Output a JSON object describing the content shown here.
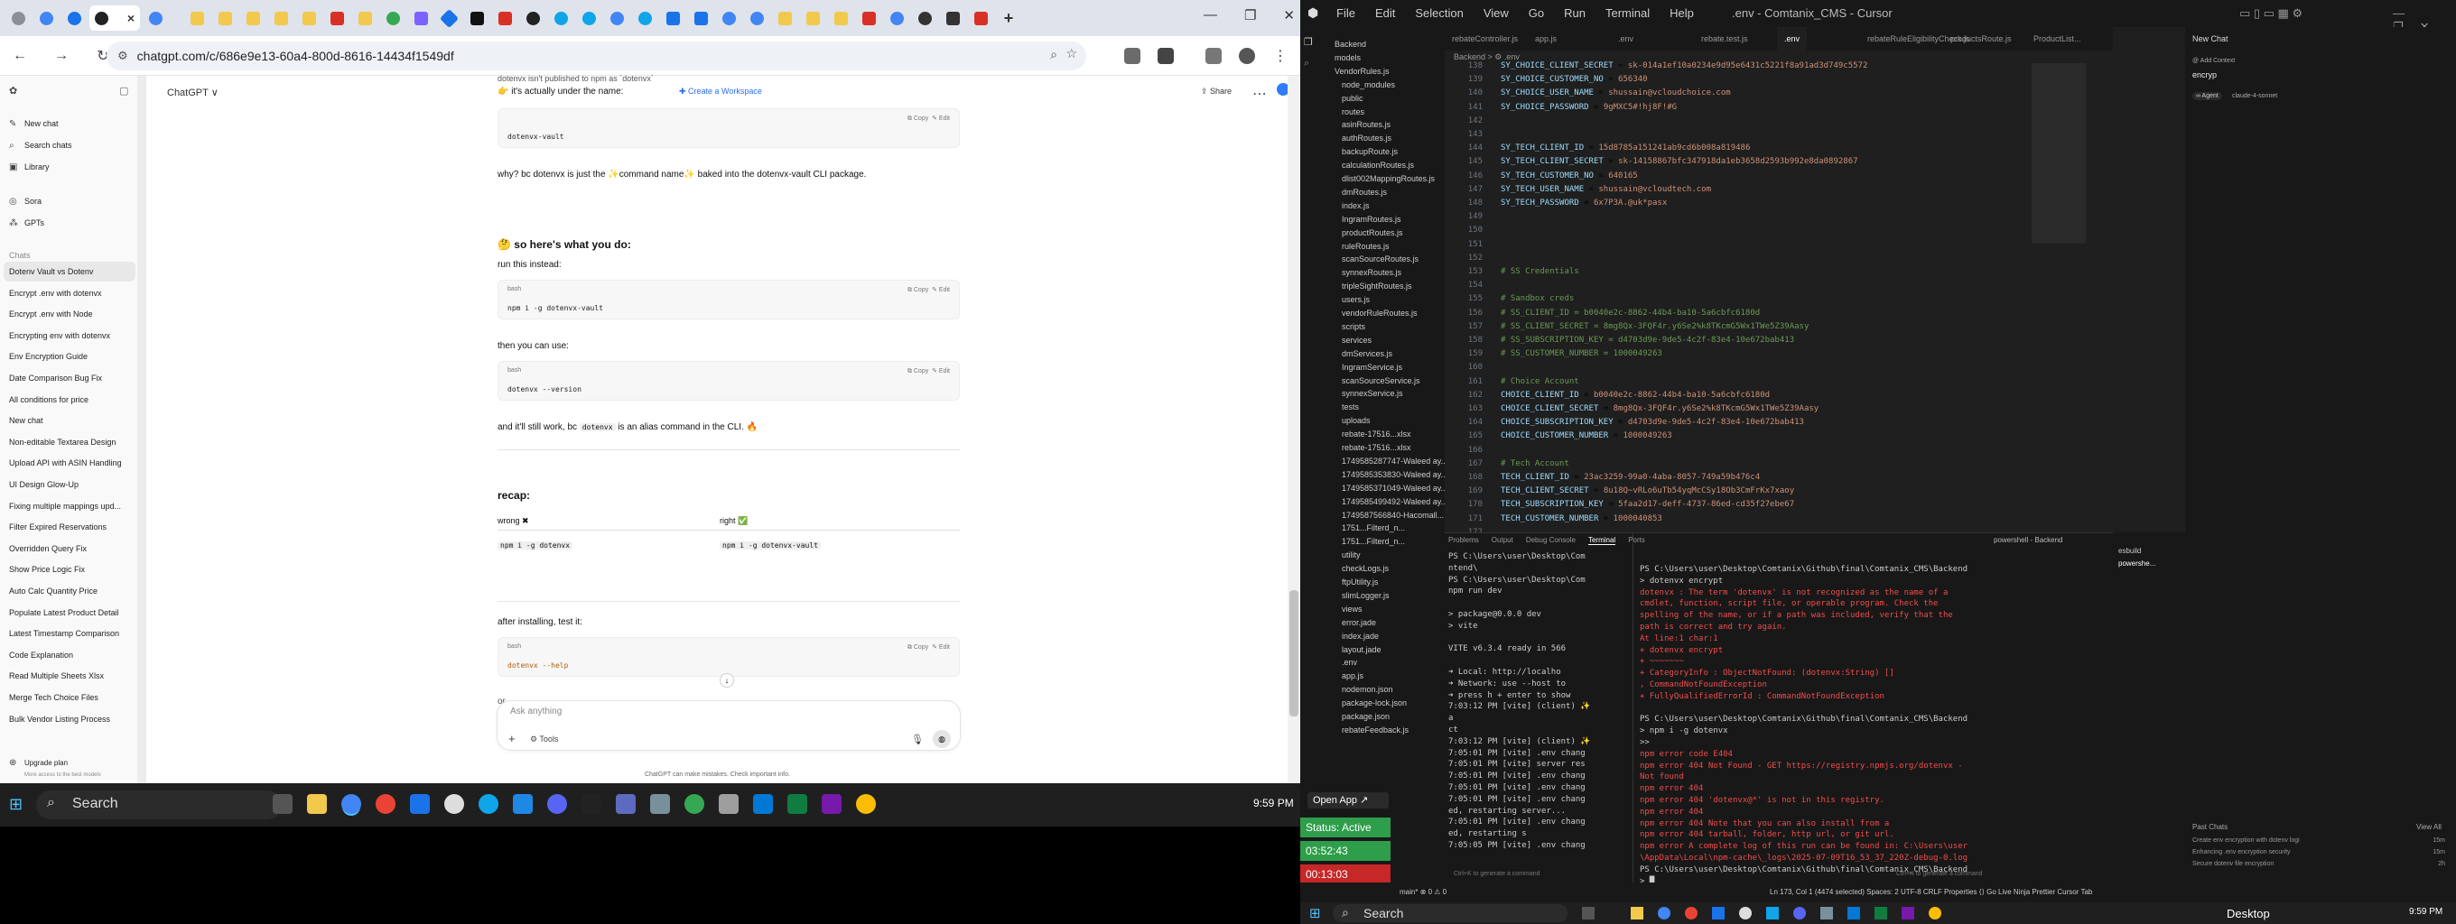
{
  "chrome": {
    "url": "chatgpt.com/c/686e9e13-60a4-800d-8616-14434f1549df",
    "active_tab_close": "×",
    "new_tab": "+",
    "window_controls": [
      "—",
      "❐",
      "✕"
    ]
  },
  "chatgpt": {
    "model_label": "ChatGPT ∨",
    "share_label": "Share",
    "sidebar": {
      "top": [
        "New chat",
        "Search chats",
        "Library",
        "Sora",
        "GPTs"
      ],
      "section": "Chats",
      "chats": [
        "Dotenv Vault vs Dotenv",
        "Encrypt .env with dotenvx",
        "Encrypt .env with Node",
        "Encrypting env with dotenvx",
        "Env Encryption Guide",
        "Date Comparison Bug Fix",
        "All conditions for price",
        "New chat",
        "Non-editable Textarea Design",
        "Upload API with ASIN Handling",
        "UI Design Glow-Up",
        "Fixing multiple mappings upd...",
        "Filter Expired Reservations",
        "Overridden Query Fix",
        "Show Price Logic Fix",
        "Auto Calc Quantity Price",
        "Populate Latest Product Detail",
        "Latest Timestamp Comparison",
        "Code Explanation",
        "Read Multiple Sheets Xlsx",
        "Merge Tech Choice Files",
        "Bulk Vendor Listing Process"
      ],
      "upgrade": "Upgrade plan",
      "upgrade_sub": "More access to the best models"
    },
    "messages": {
      "top_cut": "dotenvx isn't published to npm as `dotenvx`",
      "actually": "👉 it's actually under the name:",
      "create_ws": "✚ Create a Workspace",
      "code1": "dotenvx-vault",
      "why": "why? bc dotenvx is just the ✨command name✨ baked into the dotenvx-vault CLI package.",
      "heading": "🤔 so here's what you do:",
      "run": "run this instead:",
      "code2": "npm i -g dotenvx-vault",
      "then": "then you can use:",
      "code3": "dotenvx --version",
      "still_pre": "and it'll still work, bc",
      "still_code": "dotenvx",
      "still_post": "is an alias command in the CLI. 🔥",
      "recap": "recap:",
      "wrong": "wrong ✖",
      "right": "right ✅",
      "wrong_code": "npm i -g dotenvx",
      "right_code": "npm i -g dotenvx-vault",
      "after": "after installing, test it:",
      "code4": "dotenvx --help",
      "or": "or"
    },
    "code_lang": "bash",
    "copy_label": "⧉ Copy",
    "edit_label": "✎ Edit",
    "composer_placeholder": "Ask anything",
    "tools_label": "Tools",
    "disclaimer": "ChatGPT can make mistakes. Check important info."
  },
  "taskbar_left": {
    "search": "Search",
    "time": "9:59 PM"
  },
  "cursor": {
    "title": ".env - Comtanix_CMS - Cursor",
    "menu": [
      "File",
      "Edit",
      "Selection",
      "View",
      "Go",
      "Run",
      "Terminal",
      "Help"
    ],
    "tabs": [
      "rebateController.js",
      "app.js",
      ".env",
      "rebate.test.js",
      ".env",
      "rebateRuleEligibilityCheck.js",
      "productsRoute.js",
      "ProductList..."
    ],
    "breadcrumb": "Backend > ⚙ .env",
    "explorer": [
      "Backend",
      "models",
      "VendorRules.js",
      "node_modules",
      "public",
      "routes",
      "asinRoutes.js",
      "authRoutes.js",
      "backupRoute.js",
      "calculationRoutes.js",
      "dlist002MappingRoutes.js",
      "dmRoutes.js",
      "index.js",
      "IngramRoutes.js",
      "productRoutes.js",
      "ruleRoutes.js",
      "scanSourceRoutes.js",
      "synnexRoutes.js",
      "tripleSightRoutes.js",
      "users.js",
      "vendorRuleRoutes.js",
      "scripts",
      "services",
      "dmServices.js",
      "IngramService.js",
      "scanSourceService.js",
      "synnexService.js",
      "tests",
      "uploads",
      "rebate-17516...xlsx",
      "rebate-17516...xlsx",
      "1749585287747-Waleed ay...",
      "1749585353830-Waleed ay...",
      "1749585371049-Waleed ay...",
      "1749585499492-Waleed ay...",
      "1749587566840-Hacomall...",
      "1751...Filterd_n...",
      "1751...Filterd_n...",
      "utility",
      "checkLogs.js",
      "ftpUtility.js",
      "slimLogger.js",
      "views",
      "error.jade",
      "index.jade",
      "layout.jade",
      ".env",
      "app.js",
      "nodemon.json",
      "package-lock.json",
      "package.json",
      "rebateFeedback.js"
    ],
    "code_lines": [
      {
        "n": "138",
        "k": "SY_CHOICE_CLIENT_SECRET",
        "v": "sk-014a1ef10a0234e9d95e6431c5221f8a91ad3d749c5572",
        "t": "kv"
      },
      {
        "n": "139",
        "k": "SY_CHOICE_CUSTOMER_NO",
        "v": "656340",
        "t": "kv"
      },
      {
        "n": "140",
        "k": "SY_CHOICE_USER_NAME",
        "v": "shussain@vcloudchoice.com",
        "t": "kv"
      },
      {
        "n": "141",
        "k": "SY_CHOICE_PASSWORD",
        "v": "9gMXC5#!hj8F!#G",
        "t": "kv"
      },
      {
        "n": "142",
        "k": "",
        "v": "",
        "t": "blank"
      },
      {
        "n": "143",
        "k": "",
        "v": "",
        "t": "blank"
      },
      {
        "n": "144",
        "k": "SY_TECH_CLIENT_ID",
        "v": "15d8785a151241ab9cd6b008a819486",
        "t": "kv"
      },
      {
        "n": "145",
        "k": "SY_TECH_CLIENT_SECRET",
        "v": "sk-14158867bfc347918da1eb3658d2593b992e8da0892867",
        "t": "kv"
      },
      {
        "n": "146",
        "k": "SY_TECH_CUSTOMER_NO",
        "v": "640165",
        "t": "kv"
      },
      {
        "n": "147",
        "k": "SY_TECH_USER_NAME",
        "v": "shussain@vcloudtech.com",
        "t": "kv"
      },
      {
        "n": "148",
        "k": "SY_TECH_PASSWORD",
        "v": "6x7P3A.@uk*pasx",
        "t": "kv"
      },
      {
        "n": "149",
        "k": "",
        "v": "",
        "t": "blank"
      },
      {
        "n": "150",
        "k": "",
        "v": "",
        "t": "blank"
      },
      {
        "n": "151",
        "k": "",
        "v": "",
        "t": "blank"
      },
      {
        "n": "152",
        "k": "",
        "v": "",
        "t": "blank"
      },
      {
        "n": "153",
        "k": "",
        "v": "# SS Credentials",
        "t": "comment"
      },
      {
        "n": "154",
        "k": "",
        "v": "",
        "t": "blank"
      },
      {
        "n": "155",
        "k": "",
        "v": "# Sandbox creds",
        "t": "comment"
      },
      {
        "n": "156",
        "k": "",
        "v": "# SS_CLIENT_ID = b0040e2c-8862-44b4-ba10-5a6cbfc6180d",
        "t": "comment"
      },
      {
        "n": "157",
        "k": "",
        "v": "# SS_CLIENT_SECRET = 8mg8Qx-3FQF4r.y6Se2%k8TKcmG5Wx1TWe5Z39Aasy",
        "t": "comment"
      },
      {
        "n": "158",
        "k": "",
        "v": "# SS_SUBSCRIPTION_KEY = d4703d9e-9de5-4c2f-83e4-10e672bab413",
        "t": "comment"
      },
      {
        "n": "159",
        "k": "",
        "v": "# SS_CUSTOMER_NUMBER = 1000049263",
        "t": "comment"
      },
      {
        "n": "160",
        "k": "",
        "v": "",
        "t": "blank"
      },
      {
        "n": "161",
        "k": "",
        "v": "# Choice Account",
        "t": "comment"
      },
      {
        "n": "162",
        "k": "CHOICE_CLIENT_ID",
        "v": "b0040e2c-8862-44b4-ba10-5a6cbfc6180d",
        "t": "kv"
      },
      {
        "n": "163",
        "k": "CHOICE_CLIENT_SECRET",
        "v": "8mg8Qx-3FQF4r.y6Se2%k8TKcmG5Wx1TWe5Z39Aasy",
        "t": "kv"
      },
      {
        "n": "164",
        "k": "CHOICE_SUBSCRIPTION_KEY",
        "v": "d4703d9e-9de5-4c2f-83e4-10e672bab413",
        "t": "kv"
      },
      {
        "n": "165",
        "k": "CHOICE_CUSTOMER_NUMBER",
        "v": "1000049263",
        "t": "kv"
      },
      {
        "n": "166",
        "k": "",
        "v": "",
        "t": "blank"
      },
      {
        "n": "167",
        "k": "",
        "v": "# Tech Account",
        "t": "comment"
      },
      {
        "n": "168",
        "k": "TECH_CLIENT_ID",
        "v": "23ac3259-99a0-4aba-8057-749a59b476c4",
        "t": "kv"
      },
      {
        "n": "169",
        "k": "TECH_CLIENT_SECRET",
        "v": "8u18Q~vRLo6uTb54yqMcCSy18Ob3CmFrKx7xaoy",
        "t": "kv"
      },
      {
        "n": "170",
        "k": "TECH_SUBSCRIPTION_KEY",
        "v": "5faa2d17-deff-4737-86ed-cd35f27ebe67",
        "t": "kv"
      },
      {
        "n": "171",
        "k": "TECH_CUSTOMER_NUMBER",
        "v": "1000040853",
        "t": "kv"
      },
      {
        "n": "172",
        "k": "",
        "v": "",
        "t": "blank"
      },
      {
        "n": "173",
        "k": "",
        "v": "",
        "t": "blank"
      }
    ],
    "panel_tabs": [
      "Problems",
      "Output",
      "Debug Console",
      "Terminal",
      "Ports"
    ],
    "terminal_name": "powershell - Backend",
    "term_left": [
      "PS C:\\Users\\user\\Desktop\\Com",
      "ntend\\",
      "PS C:\\Users\\user\\Desktop\\Com",
      "npm run dev",
      "",
      "> package@0.0.0 dev",
      "> vite",
      "",
      "  VITE v6.3.4  ready in 566",
      "",
      "  ➜  Local:   http://localho",
      "  ➜  Network: use --host to",
      "  ➜  press h + enter to show",
      "7:03:12 PM [vite] (client) ✨",
      "a",
      "ct",
      "7:03:12 PM [vite] (client) ✨",
      "7:05:01 PM [vite] .env chang",
      "7:05:01 PM [vite] server res",
      "7:05:01 PM [vite] .env chang",
      "7:05:01 PM [vite] .env chang",
      "7:05:01 PM [vite] .env chang",
      "ed, restarting server...",
      "7:05:01 PM [vite] .env chang",
      "ed, restarting s",
      "7:05:05 PM [vite] .env chang"
    ],
    "term_right": [
      {
        "t": "PS C:\\Users\\user\\Desktop\\Comtanix\\Github\\final\\Comtanix_CMS\\Backend",
        "c": ""
      },
      {
        "t": "> dotenvx encrypt",
        "c": ""
      },
      {
        "t": "dotenvx : The term 'dotenvx' is not recognized as the name of a",
        "c": "err"
      },
      {
        "t": "cmdlet, function, script file, or operable program. Check the",
        "c": "err"
      },
      {
        "t": "spelling of the name, or if a path was included, verify that the",
        "c": "err"
      },
      {
        "t": "path is correct and try again.",
        "c": "err"
      },
      {
        "t": "At line:1 char:1",
        "c": "err"
      },
      {
        "t": "+ dotenvx encrypt",
        "c": "err"
      },
      {
        "t": "+ ~~~~~~~",
        "c": "err"
      },
      {
        "t": "    + CategoryInfo          : ObjectNotFound: (dotenvx:String) []",
        "c": "err"
      },
      {
        "t": "   , CommandNotFoundException",
        "c": "err"
      },
      {
        "t": "    + FullyQualifiedErrorId : CommandNotFoundException",
        "c": "err"
      },
      {
        "t": "",
        "c": ""
      },
      {
        "t": "PS C:\\Users\\user\\Desktop\\Comtanix\\Github\\final\\Comtanix_CMS\\Backend",
        "c": ""
      },
      {
        "t": "> npm i -g dotenvx",
        "c": ""
      },
      {
        "t": ">>",
        "c": ""
      },
      {
        "t": "npm error code E404",
        "c": "err"
      },
      {
        "t": "npm error 404 Not Found - GET https://registry.npmjs.org/dotenvx -",
        "c": "err"
      },
      {
        "t": " Not found",
        "c": "err"
      },
      {
        "t": "npm error 404",
        "c": "err"
      },
      {
        "t": "npm error 404  'dotenvx@*' is not in this registry.",
        "c": "err"
      },
      {
        "t": "npm error 404",
        "c": "err"
      },
      {
        "t": "npm error 404 Note that you can also install from a",
        "c": "err"
      },
      {
        "t": "npm error 404 tarball, folder, http url, or git url.",
        "c": "err"
      },
      {
        "t": "npm error A complete log of this run can be found in: C:\\Users\\user",
        "c": "err"
      },
      {
        "t": "\\AppData\\Local\\npm-cache\\_logs\\2025-07-09T16_53_37_220Z-debug-0.log",
        "c": "err"
      },
      {
        "t": "PS C:\\Users\\user\\Desktop\\Comtanix\\Github\\final\\Comtanix_CMS\\Backend",
        "c": ""
      },
      {
        "t": "> █",
        "c": ""
      }
    ],
    "term_hint_left": "Ctrl+K to generate a command",
    "term_hint_right": "Ctrl+K to generate a command",
    "term_list": [
      "esbuild",
      "powershe..."
    ],
    "chat": {
      "title": "New Chat",
      "add_context": "@ Add Context",
      "input": "encryp",
      "agent": "∞ Agent",
      "model": "claude-4-sonnet",
      "past_header": "Past Chats",
      "view_all": "View All",
      "past": [
        [
          "Create env encryption with dotenv logi",
          "15m"
        ],
        [
          "Enhancing .env encryption security",
          "15m"
        ],
        [
          "Secure dotenv file encryption",
          "2h"
        ]
      ]
    },
    "overlay": {
      "open_app": "Open App ↗",
      "status": "Status: Active",
      "timer1": "03:52:43",
      "timer2": "00:13:03"
    },
    "status": {
      "left": "main* ⊗ 0 ⚠ 0",
      "right": "Ln 173, Col 1 (4474 selected)   Spaces: 2   UTF-8   CRLF   Properties   ⟨⟩ Go Live   Ninja   Prettier   Cursor Tab"
    },
    "taskbar": {
      "search": "Search",
      "desktop": "Desktop",
      "time": "9:59 PM"
    }
  }
}
